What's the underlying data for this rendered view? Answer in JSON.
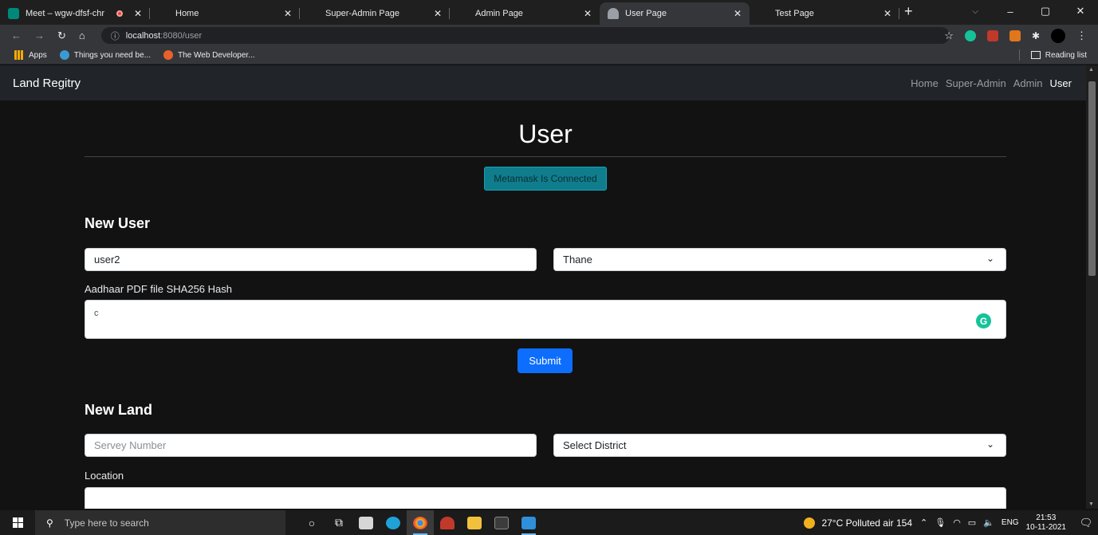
{
  "browser": {
    "tabs": [
      {
        "title": "Meet – wgw-dfsf-chr",
        "favicon_color": "#00897b",
        "recording": true
      },
      {
        "title": "Home",
        "favicon_color": ""
      },
      {
        "title": "Super-Admin Page",
        "favicon_color": ""
      },
      {
        "title": "Admin Page",
        "favicon_color": ""
      },
      {
        "title": "User Page",
        "favicon_color": "#e8eaed",
        "active": true
      },
      {
        "title": "Test Page",
        "favicon_color": ""
      }
    ],
    "new_tab": "+",
    "window_controls": {
      "minimize": "–",
      "maximize": "▢",
      "close": "✕"
    },
    "url_host": "localhost",
    "url_path": ":8080/user",
    "bookmarks": [
      "Apps",
      "Things you need be...",
      "The Web Developer..."
    ],
    "reading_list": "Reading list"
  },
  "navbar": {
    "brand": "Land Regitry",
    "links": [
      "Home",
      "Super-Admin",
      "Admin",
      "User"
    ],
    "active_link": "User"
  },
  "page": {
    "heading": "User",
    "metamask_status": "Metamask Is Connected",
    "new_user": {
      "title": "New User",
      "name_value": "user2",
      "district_value": "Thane",
      "hash_label": "Aadhaar PDF file SHA256 Hash",
      "hash_value": "c",
      "submit_label": "Submit"
    },
    "new_land": {
      "title": "New Land",
      "survey_placeholder": "Servey Number",
      "district_placeholder": "Select District",
      "location_label": "Location"
    }
  },
  "taskbar": {
    "search_placeholder": "Type here to search",
    "weather": "27°C  Polluted air 154",
    "language": "ENG",
    "time": "21:53",
    "date": "10-11-2021"
  },
  "colors": {
    "navbar_bg": "#212529",
    "page_bg": "#121212",
    "metamask_bg": "#0f7d8c",
    "submit_bg": "#0d6efd"
  }
}
